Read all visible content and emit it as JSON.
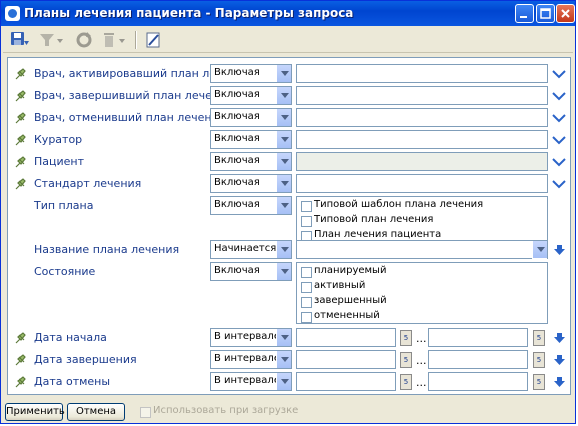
{
  "window": {
    "title": "Планы лечения пациента - Параметры запроса"
  },
  "rows": [
    {
      "label": "Врач, активировавший план лечения",
      "op": "Включая"
    },
    {
      "label": "Врач, завершивший план лечения",
      "op": "Включая"
    },
    {
      "label": "Врач, отменивший план лечения",
      "op": "Включая"
    },
    {
      "label": "Куратор",
      "op": "Включая"
    },
    {
      "label": "Пациент",
      "op": "Включая"
    },
    {
      "label": "Стандарт лечения",
      "op": "Включая"
    }
  ],
  "plan_type": {
    "label": "Тип плана",
    "op": "Включая",
    "options": [
      "Типовой шаблон плана лечения",
      "Типовой план лечения",
      "План лечения пациента"
    ]
  },
  "plan_name": {
    "label": "Название плана лечения",
    "op": "Начинается с"
  },
  "state": {
    "label": "Состояние",
    "op": "Включая",
    "options": [
      "планируемый",
      "активный",
      "завершенный",
      "отмененный"
    ]
  },
  "dates": [
    {
      "label": "Дата начала",
      "op": "В интервале",
      "sep": "..."
    },
    {
      "label": "Дата завершения",
      "op": "В интервале",
      "sep": "..."
    },
    {
      "label": "Дата отмены",
      "op": "В интервале",
      "sep": "..."
    }
  ],
  "buttons": {
    "apply": "Применить",
    "cancel": "Отмена"
  },
  "use_on_load": "Использовать при загрузке",
  "icons": [
    "save-icon",
    "filter-icon",
    "refresh-icon",
    "trash-icon",
    "edit-icon",
    "pin-icon",
    "chevron-down-icon",
    "arrow-down-icon",
    "calendar-icon"
  ],
  "colors": {
    "label": "#1a3a8c",
    "title_bar": "#0a5fe3",
    "accent_arrow": "#2a63c8"
  }
}
